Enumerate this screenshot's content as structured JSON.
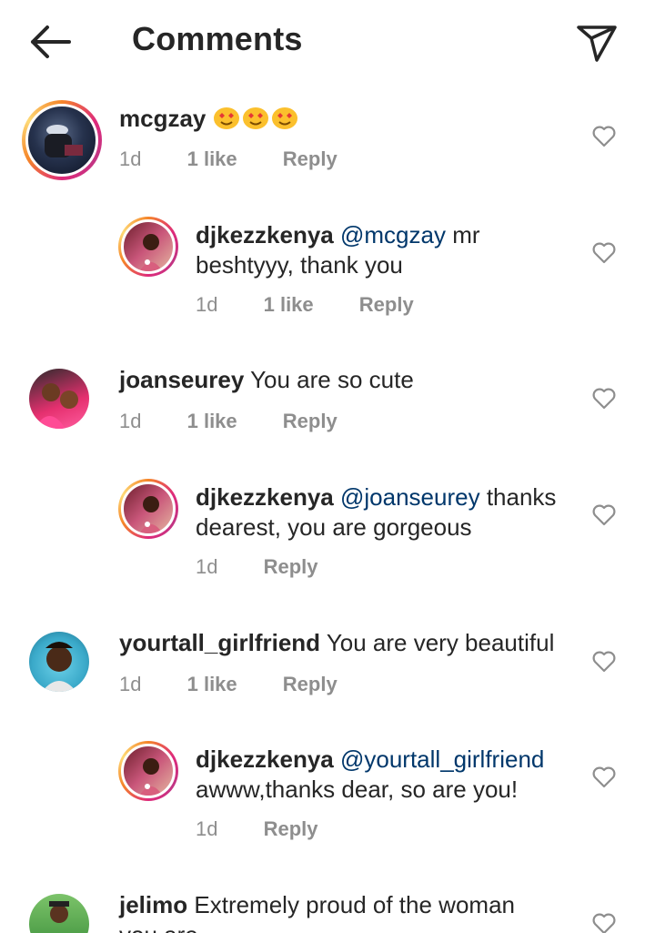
{
  "header": {
    "title": "Comments",
    "back_icon": "arrow-left-icon",
    "send_icon": "paper-plane-icon"
  },
  "comments": [
    {
      "username": "mcgzay",
      "text": "",
      "emoji": [
        "smiling-heart-eyes",
        "smiling-heart-eyes",
        "smiling-heart-eyes"
      ],
      "time": "1d",
      "likes": "1 like",
      "reply": "Reply"
    },
    {
      "username": "djkezzkenya",
      "mention": "@mcgzay",
      "text": "mr beshtyyy, thank you",
      "time": "1d",
      "likes": "1 like",
      "reply": "Reply"
    },
    {
      "username": "joanseurey",
      "text": "You are so cute",
      "time": "1d",
      "likes": "1 like",
      "reply": "Reply"
    },
    {
      "username": "djkezzkenya",
      "mention": "@joanseurey",
      "text": "thanks dearest, you are gorgeous",
      "time": "1d",
      "reply": "Reply"
    },
    {
      "username": "yourtall_girlfriend",
      "text": "You are very beautiful",
      "time": "1d",
      "likes": "1 like",
      "reply": "Reply"
    },
    {
      "username": "djkezzkenya",
      "mention": "@yourtall_girlfriend",
      "text": "awww,thanks dear, so are you!",
      "time": "1d",
      "reply": "Reply"
    },
    {
      "username": "jelimo",
      "text": "Extremely proud of the woman",
      "text2": "you are"
    }
  ],
  "colors": {
    "mention": "#00376b",
    "meta": "#8e8e8e",
    "text": "#262626"
  }
}
